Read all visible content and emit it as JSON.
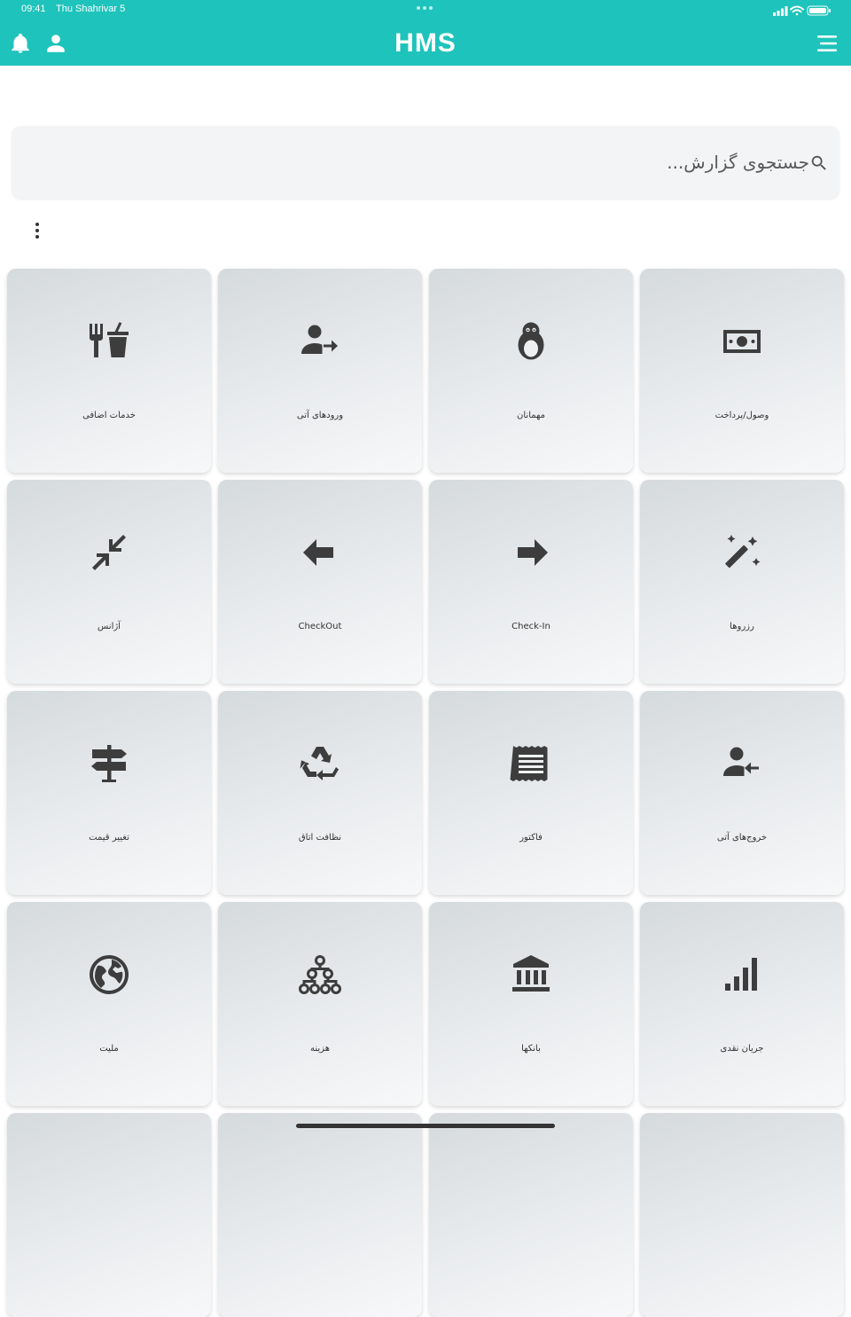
{
  "status_bar": {
    "time": "09:41",
    "date": "Thu Shahrivar 5"
  },
  "header": {
    "title": "HMS"
  },
  "search": {
    "placeholder": "جستجوی گزارش..."
  },
  "tiles": [
    {
      "label": "خدمات اضافی",
      "icon": "restaurant-icon"
    },
    {
      "label": "ورودهای آتی",
      "icon": "person-arrow-in-icon"
    },
    {
      "label": "مهمانان",
      "icon": "penguin-icon"
    },
    {
      "label": "وصول/پرداخت",
      "icon": "cash-icon"
    },
    {
      "label": "آژانس",
      "icon": "compress-icon"
    },
    {
      "label": "CheckOut",
      "icon": "arrow-left-icon"
    },
    {
      "label": "Check-In",
      "icon": "arrow-right-icon"
    },
    {
      "label": "رزروها",
      "icon": "magic-wand-icon"
    },
    {
      "label": "تغییر قیمت",
      "icon": "signpost-icon"
    },
    {
      "label": "نظافت اتاق",
      "icon": "recycle-icon"
    },
    {
      "label": "فاکتور",
      "icon": "receipt-icon"
    },
    {
      "label": "خروج‌های آتی",
      "icon": "person-arrow-out-icon"
    },
    {
      "label": "ملیت",
      "icon": "globe-icon"
    },
    {
      "label": "هزینه",
      "icon": "hierarchy-icon"
    },
    {
      "label": "بانکها",
      "icon": "bank-icon"
    },
    {
      "label": "جریان نقدی",
      "icon": "signal-bars-icon"
    }
  ]
}
